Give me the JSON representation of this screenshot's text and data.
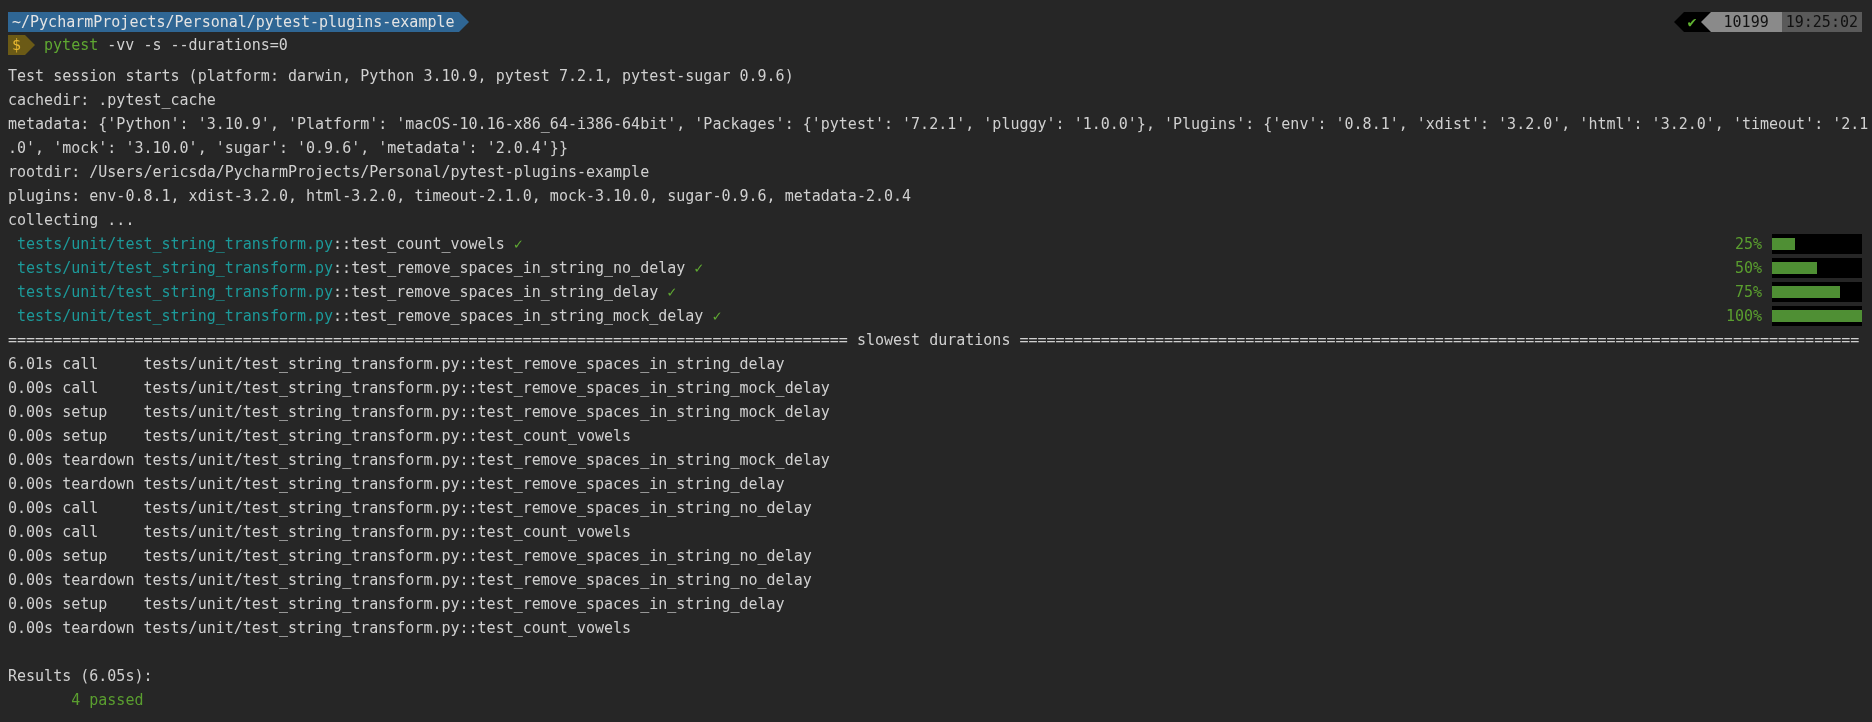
{
  "prompt": {
    "path": "~/PycharmProjects/Personal/pytest-plugins-example",
    "symbol": "$",
    "command": "pytest",
    "args": "-vv -s --durations=0"
  },
  "status": {
    "check": "✔",
    "count": "10199",
    "time": "19:25:02"
  },
  "header_lines": [
    "Test session starts (platform: darwin, Python 3.10.9, pytest 7.2.1, pytest-sugar 0.9.6)",
    "cachedir: .pytest_cache",
    "metadata: {'Python': '3.10.9', 'Platform': 'macOS-10.16-x86_64-i386-64bit', 'Packages': {'pytest': '7.2.1', 'pluggy': '1.0.0'}, 'Plugins': {'env': '0.8.1', 'xdist': '3.2.0', 'html': '3.2.0', 'timeout': '2.1",
    ".0', 'mock': '3.10.0', 'sugar': '0.9.6', 'metadata': '2.0.4'}}",
    "rootdir: /Users/ericsda/PycharmProjects/Personal/pytest-plugins-example",
    "plugins: env-0.8.1, xdist-3.2.0, html-3.2.0, timeout-2.1.0, mock-3.10.0, sugar-0.9.6, metadata-2.0.4",
    "collecting ..."
  ],
  "tests": [
    {
      "file": "tests/unit/test_string_transform.py",
      "name": "::test_count_vowels",
      "mark": "✓",
      "percent": "25%",
      "level": 0.25
    },
    {
      "file": "tests/unit/test_string_transform.py",
      "name": "::test_remove_spaces_in_string_no_delay",
      "mark": "✓",
      "percent": "50%",
      "level": 0.5
    },
    {
      "file": "tests/unit/test_string_transform.py",
      "name": "::test_remove_spaces_in_string_delay",
      "mark": "✓",
      "percent": "75%",
      "level": 0.75
    },
    {
      "file": "tests/unit/test_string_transform.py",
      "name": "::test_remove_spaces_in_string_mock_delay",
      "mark": "✓",
      "percent": "100%",
      "level": 1
    }
  ],
  "separator": "============================================================================================= slowest durations =============================================================================================",
  "durations": [
    {
      "time": "6.01s",
      "phase": "call",
      "test": "tests/unit/test_string_transform.py::test_remove_spaces_in_string_delay"
    },
    {
      "time": "0.00s",
      "phase": "call",
      "test": "tests/unit/test_string_transform.py::test_remove_spaces_in_string_mock_delay"
    },
    {
      "time": "0.00s",
      "phase": "setup",
      "test": "tests/unit/test_string_transform.py::test_remove_spaces_in_string_mock_delay"
    },
    {
      "time": "0.00s",
      "phase": "setup",
      "test": "tests/unit/test_string_transform.py::test_count_vowels"
    },
    {
      "time": "0.00s",
      "phase": "teardown",
      "test": "tests/unit/test_string_transform.py::test_remove_spaces_in_string_mock_delay"
    },
    {
      "time": "0.00s",
      "phase": "teardown",
      "test": "tests/unit/test_string_transform.py::test_remove_spaces_in_string_delay"
    },
    {
      "time": "0.00s",
      "phase": "call",
      "test": "tests/unit/test_string_transform.py::test_remove_spaces_in_string_no_delay"
    },
    {
      "time": "0.00s",
      "phase": "call",
      "test": "tests/unit/test_string_transform.py::test_count_vowels"
    },
    {
      "time": "0.00s",
      "phase": "setup",
      "test": "tests/unit/test_string_transform.py::test_remove_spaces_in_string_no_delay"
    },
    {
      "time": "0.00s",
      "phase": "teardown",
      "test": "tests/unit/test_string_transform.py::test_remove_spaces_in_string_no_delay"
    },
    {
      "time": "0.00s",
      "phase": "setup",
      "test": "tests/unit/test_string_transform.py::test_remove_spaces_in_string_delay"
    },
    {
      "time": "0.00s",
      "phase": "teardown",
      "test": "tests/unit/test_string_transform.py::test_count_vowels"
    }
  ],
  "results": {
    "title": "Results (6.05s):",
    "summary": "4 passed"
  }
}
